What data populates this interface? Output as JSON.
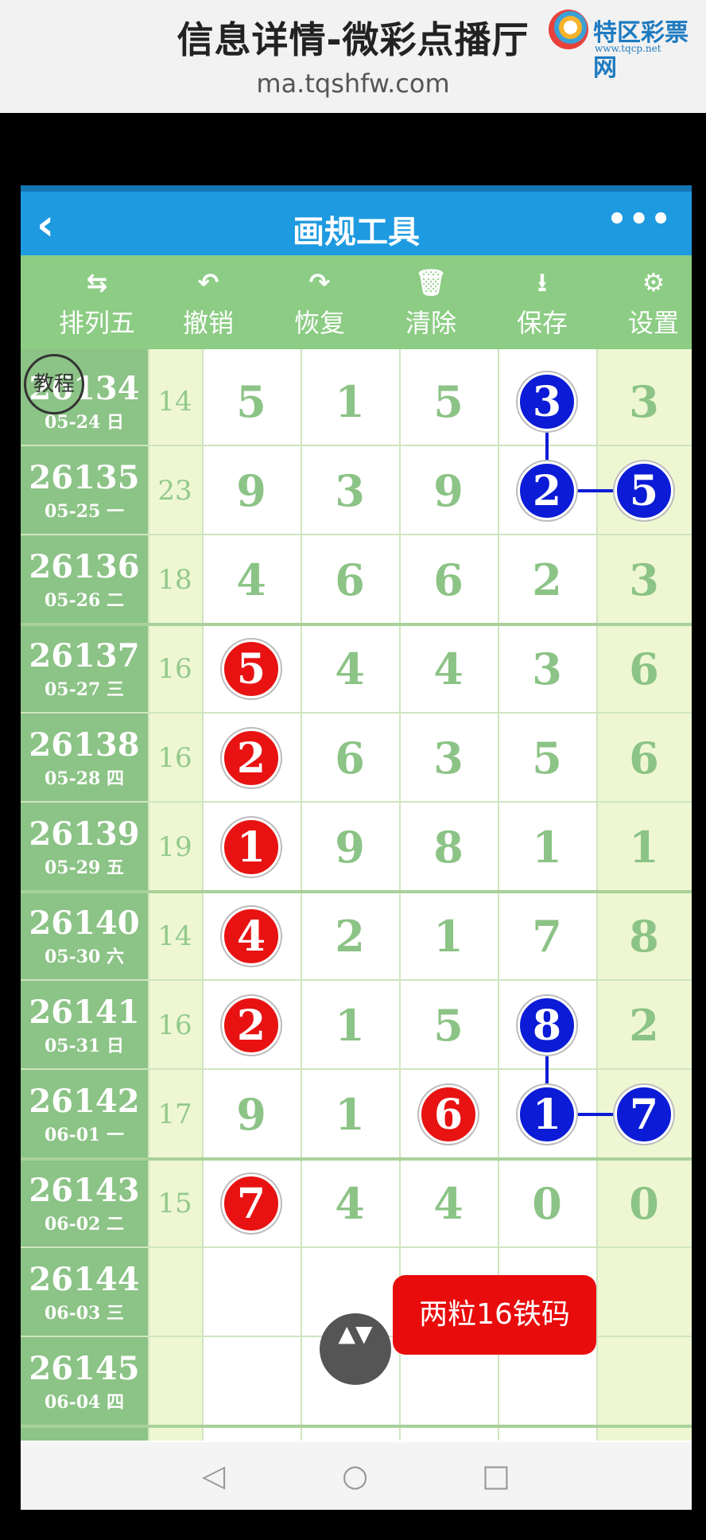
{
  "header": {
    "title": "信息详情-微彩点播厅",
    "url": "ma.tqshfw.com",
    "logo_text": "特区彩票网",
    "logo_sub": "www.tqcp.net"
  },
  "navbar": {
    "back_icon": "‹",
    "title": "画规工具",
    "more_icon": "•••"
  },
  "toolbar": [
    {
      "icon": "⇆",
      "label": "排列五"
    },
    {
      "icon": "↶",
      "label": "撤销"
    },
    {
      "icon": "↷",
      "label": "恢复"
    },
    {
      "icon": "🗑",
      "label": "清除"
    },
    {
      "icon": "⭳",
      "label": "保存"
    },
    {
      "icon": "⚙",
      "label": "设置"
    }
  ],
  "rows": [
    {
      "period": "26134",
      "date": "05-24 日",
      "sum": "14",
      "digits": [
        "5",
        "1",
        "5",
        "3",
        "3"
      ]
    },
    {
      "period": "26135",
      "date": "05-25 一",
      "sum": "23",
      "digits": [
        "9",
        "3",
        "9",
        "2",
        "5"
      ]
    },
    {
      "period": "26136",
      "date": "05-26 二",
      "sum": "18",
      "digits": [
        "4",
        "6",
        "6",
        "2",
        "3"
      ]
    },
    {
      "period": "26137",
      "date": "05-27 三",
      "sum": "16",
      "digits": [
        "5",
        "4",
        "4",
        "3",
        "6"
      ]
    },
    {
      "period": "26138",
      "date": "05-28 四",
      "sum": "16",
      "digits": [
        "2",
        "6",
        "3",
        "5",
        "6"
      ]
    },
    {
      "period": "26139",
      "date": "05-29 五",
      "sum": "19",
      "digits": [
        "1",
        "9",
        "8",
        "1",
        "1"
      ]
    },
    {
      "period": "26140",
      "date": "05-30 六",
      "sum": "14",
      "digits": [
        "4",
        "2",
        "1",
        "7",
        "8"
      ]
    },
    {
      "period": "26141",
      "date": "05-31 日",
      "sum": "16",
      "digits": [
        "2",
        "1",
        "5",
        "8",
        "2"
      ]
    },
    {
      "period": "26142",
      "date": "06-01 一",
      "sum": "17",
      "digits": [
        "9",
        "1",
        "6",
        "1",
        "7"
      ]
    },
    {
      "period": "26143",
      "date": "06-02 二",
      "sum": "15",
      "digits": [
        "7",
        "4",
        "4",
        "0",
        "0"
      ]
    },
    {
      "period": "26144",
      "date": "06-03 三",
      "sum": "",
      "digits": [
        "",
        "",
        "",
        "",
        ""
      ]
    },
    {
      "period": "26145",
      "date": "06-04 四",
      "sum": "",
      "digits": [
        "",
        "",
        "",
        "",
        ""
      ]
    }
  ],
  "marks": [
    {
      "row": 0,
      "col": 3,
      "color": "blue"
    },
    {
      "row": 1,
      "col": 3,
      "color": "blue"
    },
    {
      "row": 1,
      "col": 4,
      "color": "blue"
    },
    {
      "row": 3,
      "col": 0,
      "color": "red"
    },
    {
      "row": 4,
      "col": 0,
      "color": "red"
    },
    {
      "row": 5,
      "col": 0,
      "color": "red"
    },
    {
      "row": 6,
      "col": 0,
      "color": "red"
    },
    {
      "row": 7,
      "col": 0,
      "color": "red"
    },
    {
      "row": 7,
      "col": 3,
      "color": "blue"
    },
    {
      "row": 8,
      "col": 2,
      "color": "red"
    },
    {
      "row": 8,
      "col": 3,
      "color": "blue"
    },
    {
      "row": 8,
      "col": 4,
      "color": "blue"
    },
    {
      "row": 9,
      "col": 0,
      "color": "red"
    }
  ],
  "links": [
    {
      "from": [
        0,
        3
      ],
      "to": [
        1,
        3
      ]
    },
    {
      "from": [
        1,
        3
      ],
      "to": [
        1,
        4
      ]
    },
    {
      "from": [
        7,
        3
      ],
      "to": [
        8,
        3
      ]
    },
    {
      "from": [
        8,
        3
      ],
      "to": [
        8,
        4
      ]
    }
  ],
  "teach_label": "教程",
  "tip": "两粒16铁码",
  "scroll_icon": "▲▼",
  "system_nav": {
    "back": "◁",
    "home": "○",
    "recent": "□"
  },
  "colors": {
    "primary": "#1e9ae0",
    "green": "#8cc386",
    "red": "#e81212",
    "blue": "#0b1bd6"
  }
}
